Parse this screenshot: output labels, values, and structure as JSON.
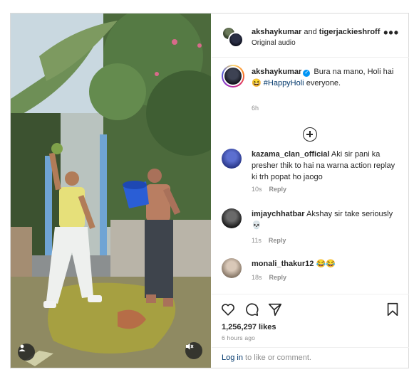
{
  "header": {
    "user1": "akshaykumar",
    "and_text": " and ",
    "user2": "tigerjackieshroff",
    "audio": "Original audio",
    "more": "•••"
  },
  "caption": {
    "username": "akshaykumar",
    "verified_mark": "✓",
    "text_before": " Bura na mano, Holi hai 😆 ",
    "hashtag": "#HappyHoli",
    "text_after": " everyone.",
    "time": "6h"
  },
  "comments": [
    {
      "username": "kazama_clan_official",
      "text": " Aki sir pani ka presher thik to hai na warna action replay ki trh popat ho jaogo",
      "time": "10s",
      "reply": "Reply"
    },
    {
      "username": "imjaychhatbar",
      "text": " Akshay sir take seriously 💀",
      "time": "11s",
      "reply": "Reply"
    },
    {
      "username": "monali_thakur12",
      "text": " 😂😂",
      "time": "18s",
      "reply": "Reply"
    }
  ],
  "engagement": {
    "likes": "1,256,297 likes",
    "time_ago": "6 hours ago"
  },
  "footer": {
    "login_link": "Log in",
    "login_rest": " to like or comment."
  },
  "icons": {
    "heart": "heart-icon",
    "comment": "comment-icon",
    "share": "share-icon",
    "save": "bookmark-icon",
    "add": "add-comment-icon",
    "user": "tagged-user-icon",
    "mute": "mute-icon"
  },
  "colors": {
    "link": "#00376b",
    "verified": "#0095f6",
    "muted_text": "#8e8e8e"
  }
}
